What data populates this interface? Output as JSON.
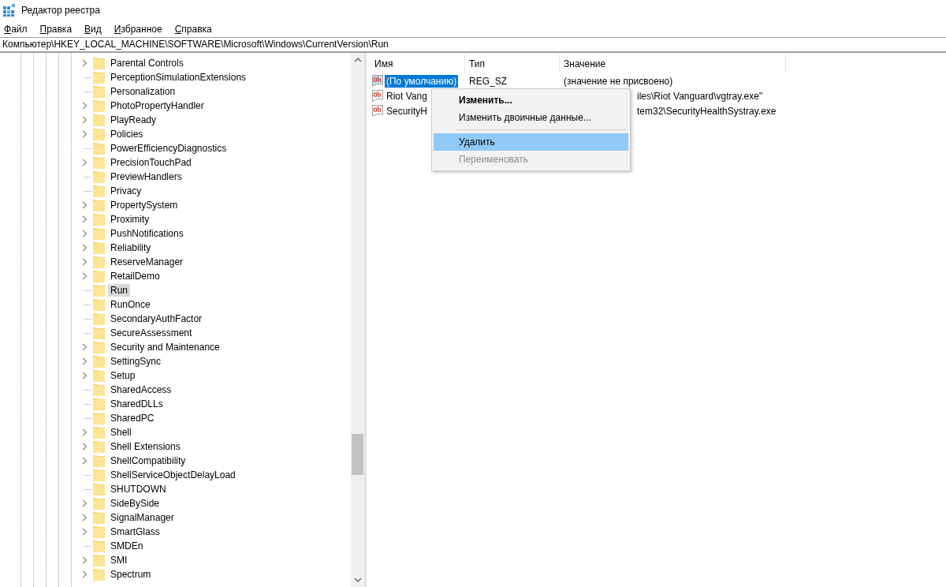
{
  "window": {
    "title": "Редактор реестра"
  },
  "menu": [
    {
      "label": "Файл"
    },
    {
      "label": "Правка"
    },
    {
      "label": "Вид"
    },
    {
      "label": "Избранное"
    },
    {
      "label": "Справка"
    }
  ],
  "address": "Компьютер\\HKEY_LOCAL_MACHINE\\SOFTWARE\\Microsoft\\Windows\\CurrentVersion\\Run",
  "tree": [
    {
      "label": "Parental Controls",
      "expandable": true,
      "selected": false
    },
    {
      "label": "PerceptionSimulationExtensions",
      "expandable": false,
      "selected": false
    },
    {
      "label": "Personalization",
      "expandable": false,
      "selected": false
    },
    {
      "label": "PhotoPropertyHandler",
      "expandable": true,
      "selected": false
    },
    {
      "label": "PlayReady",
      "expandable": true,
      "selected": false
    },
    {
      "label": "Policies",
      "expandable": true,
      "selected": false
    },
    {
      "label": "PowerEfficiencyDiagnostics",
      "expandable": false,
      "selected": false
    },
    {
      "label": "PrecisionTouchPad",
      "expandable": true,
      "selected": false
    },
    {
      "label": "PreviewHandlers",
      "expandable": false,
      "selected": false
    },
    {
      "label": "Privacy",
      "expandable": false,
      "selected": false
    },
    {
      "label": "PropertySystem",
      "expandable": true,
      "selected": false
    },
    {
      "label": "Proximity",
      "expandable": true,
      "selected": false
    },
    {
      "label": "PushNotifications",
      "expandable": true,
      "selected": false
    },
    {
      "label": "Reliability",
      "expandable": true,
      "selected": false
    },
    {
      "label": "ReserveManager",
      "expandable": true,
      "selected": false
    },
    {
      "label": "RetailDemo",
      "expandable": true,
      "selected": false
    },
    {
      "label": "Run",
      "expandable": false,
      "selected": true
    },
    {
      "label": "RunOnce",
      "expandable": false,
      "selected": false
    },
    {
      "label": "SecondaryAuthFactor",
      "expandable": false,
      "selected": false
    },
    {
      "label": "SecureAssessment",
      "expandable": false,
      "selected": false
    },
    {
      "label": "Security and Maintenance",
      "expandable": true,
      "selected": false
    },
    {
      "label": "SettingSync",
      "expandable": true,
      "selected": false
    },
    {
      "label": "Setup",
      "expandable": true,
      "selected": false
    },
    {
      "label": "SharedAccess",
      "expandable": false,
      "selected": false
    },
    {
      "label": "SharedDLLs",
      "expandable": false,
      "selected": false
    },
    {
      "label": "SharedPC",
      "expandable": false,
      "selected": false
    },
    {
      "label": "Shell",
      "expandable": true,
      "selected": false
    },
    {
      "label": "Shell Extensions",
      "expandable": true,
      "selected": false
    },
    {
      "label": "ShellCompatibility",
      "expandable": true,
      "selected": false
    },
    {
      "label": "ShellServiceObjectDelayLoad",
      "expandable": false,
      "selected": false
    },
    {
      "label": "SHUTDOWN",
      "expandable": false,
      "selected": false
    },
    {
      "label": "SideBySide",
      "expandable": true,
      "selected": false
    },
    {
      "label": "SignalManager",
      "expandable": true,
      "selected": false
    },
    {
      "label": "SmartGlass",
      "expandable": true,
      "selected": false
    },
    {
      "label": "SMDEn",
      "expandable": false,
      "selected": false
    },
    {
      "label": "SMI",
      "expandable": true,
      "selected": false
    },
    {
      "label": "Spectrum",
      "expandable": true,
      "selected": false
    }
  ],
  "table": {
    "columns": [
      "Имя",
      "Тип",
      "Значение"
    ],
    "rows": [
      {
        "name": "(По умолчанию)",
        "type": "REG_SZ",
        "value": "(значение не присвоено)",
        "selected": true,
        "covered": false
      },
      {
        "name": "Riot Vang",
        "value": "iles\\Riot Vanguard\\vgtray.exe\"",
        "selected": false,
        "covered": true
      },
      {
        "name": "SecurityH",
        "value": "tem32\\SecurityHealthSystray.exe",
        "selected": false,
        "covered": true
      }
    ]
  },
  "context_menu": [
    {
      "kind": "item",
      "label": "Изменить...",
      "default": true,
      "disabled": false,
      "selected": false
    },
    {
      "kind": "item",
      "label": "Изменить двоичные данные...",
      "default": false,
      "disabled": false,
      "selected": false
    },
    {
      "kind": "separator"
    },
    {
      "kind": "item",
      "label": "Удалить",
      "default": false,
      "disabled": false,
      "selected": true
    },
    {
      "kind": "item",
      "label": "Переименовать",
      "default": false,
      "disabled": true,
      "selected": false
    }
  ]
}
